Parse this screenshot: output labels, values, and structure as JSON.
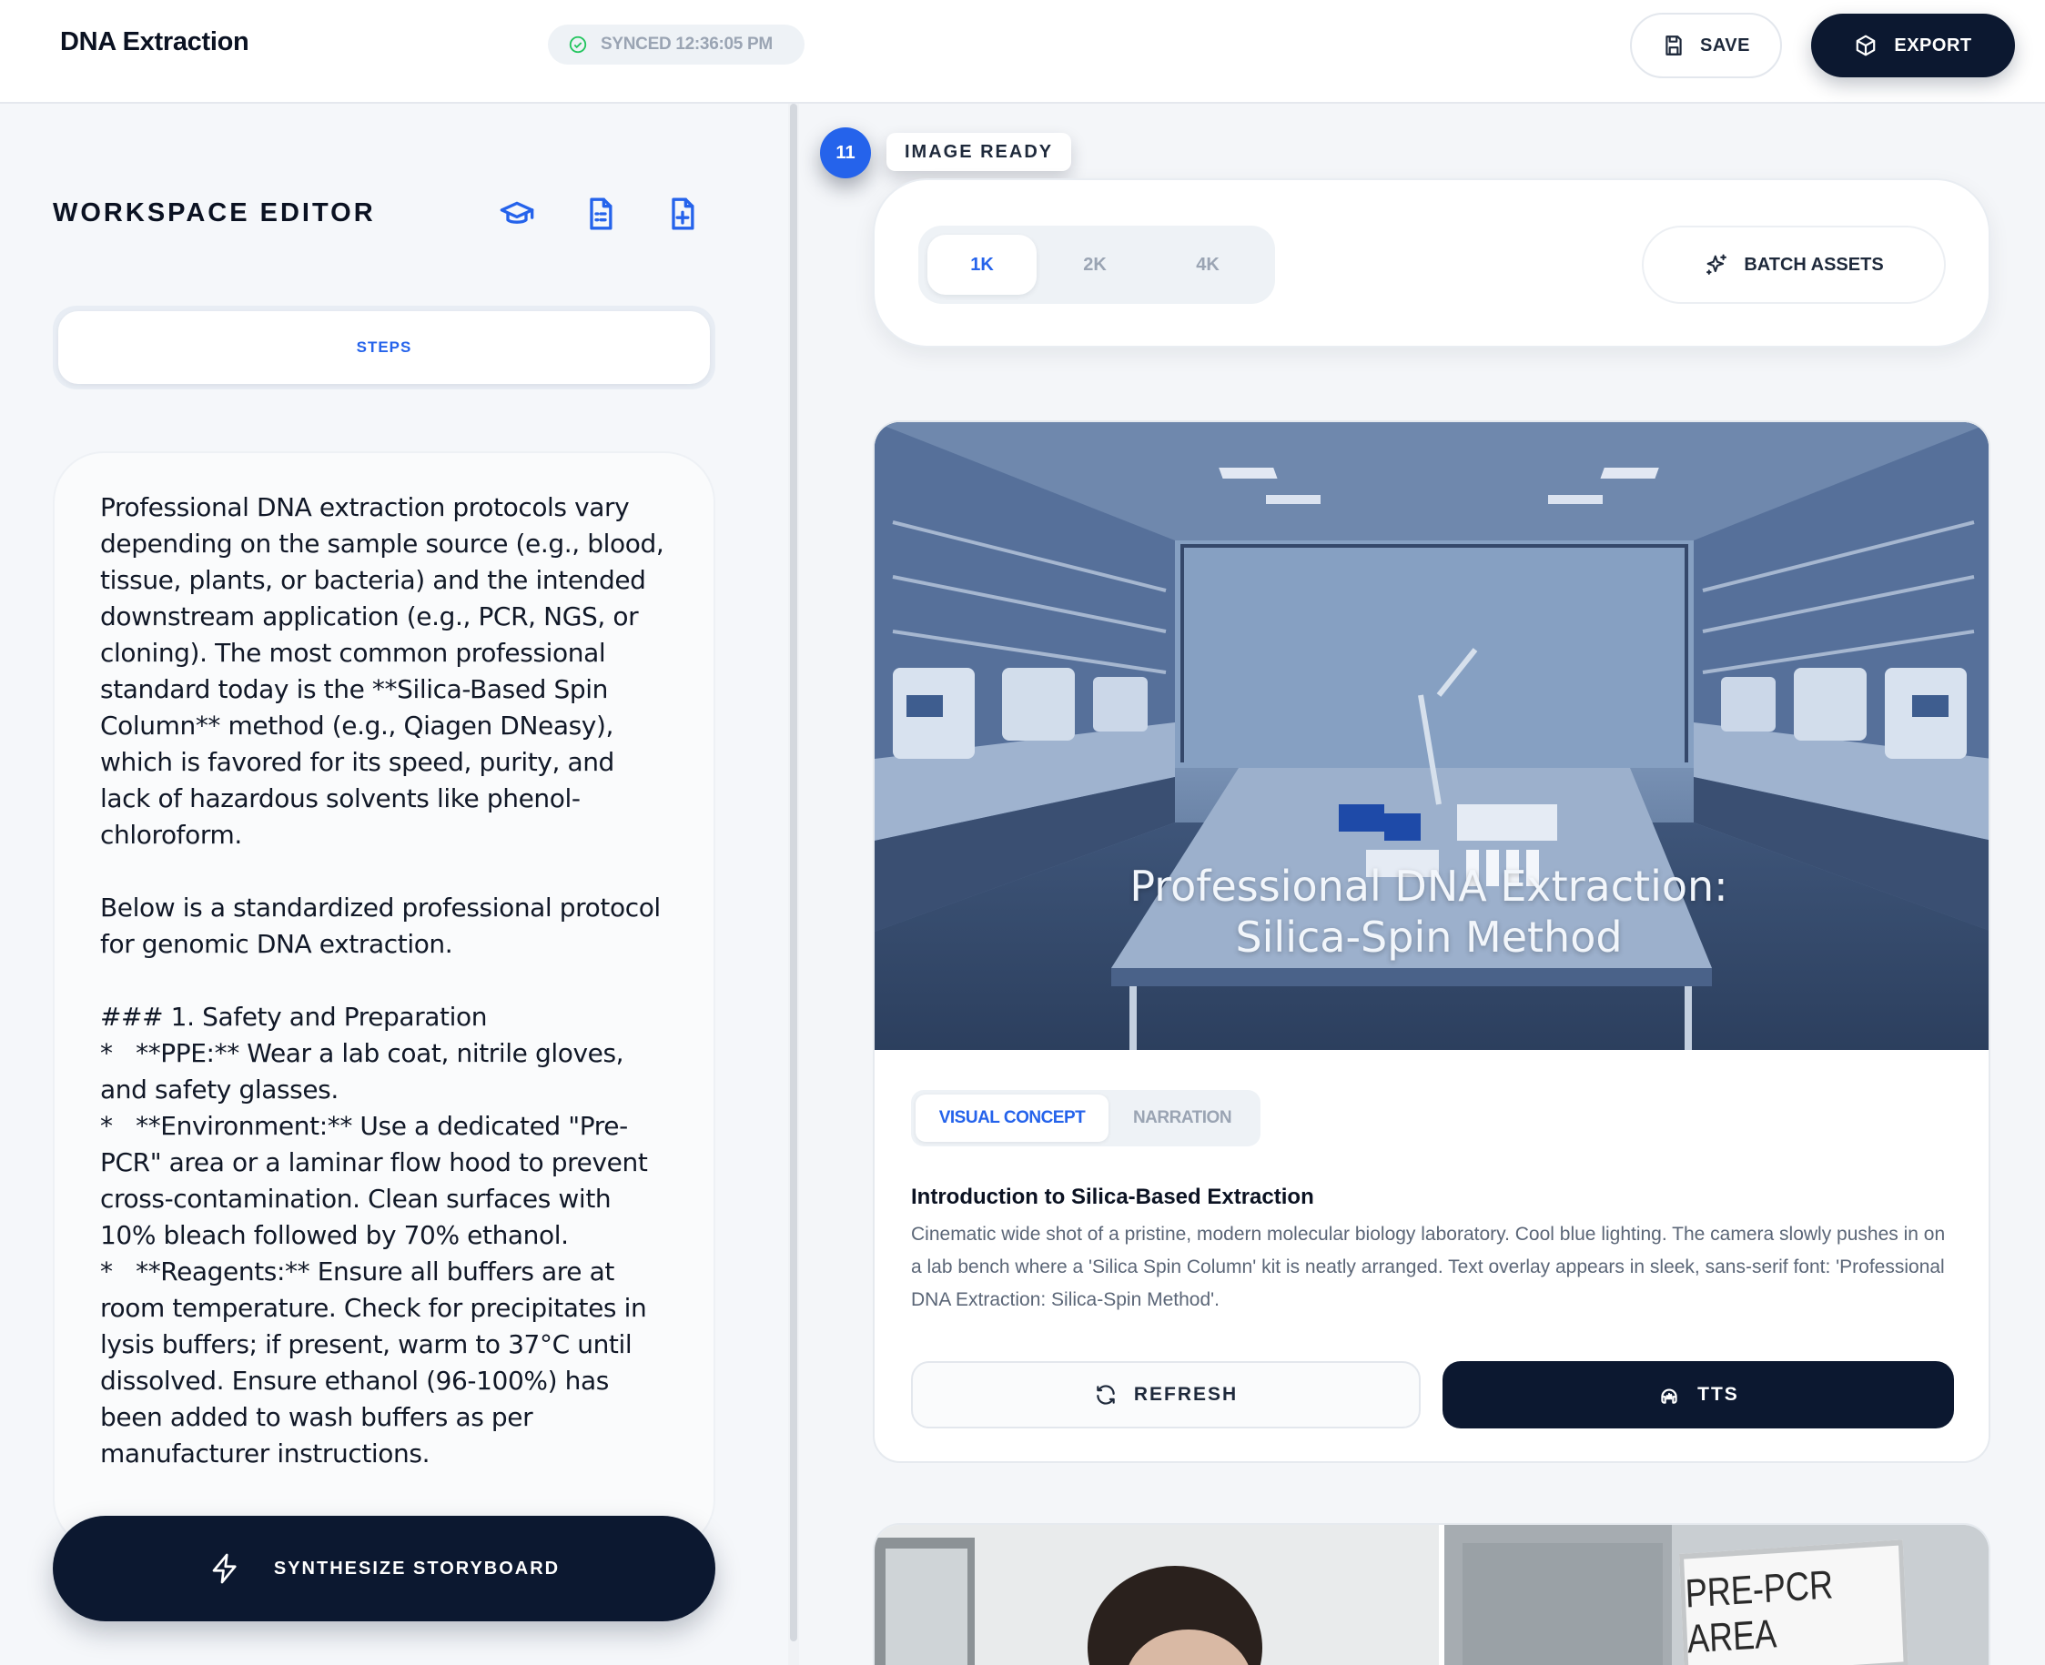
{
  "header": {
    "title": "DNA Extraction",
    "sync_status": "SYNCED 12:36:05 PM",
    "save_label": "SAVE",
    "export_label": "EXPORT"
  },
  "left_panel": {
    "title": "WORKSPACE EDITOR",
    "tool_icons": [
      "graduation-cap-icon",
      "file-list-icon",
      "file-plus-icon"
    ],
    "tab_label": "STEPS",
    "editor_text": "Professional DNA extraction protocols vary depending on the sample source (e.g., blood, tissue, plants, or bacteria) and the intended downstream application (e.g., PCR, NGS, or cloning). The most common professional standard today is the **Silica-Based Spin Column** method (e.g., Qiagen DNeasy), which is favored for its speed, purity, and lack of hazardous solvents like phenol-chloroform.\n\nBelow is a standardized professional protocol for genomic DNA extraction.\n\n### 1. Safety and Preparation\n*   **PPE:** Wear a lab coat, nitrile gloves, and safety glasses.\n*   **Environment:** Use a dedicated \"Pre-PCR\" area or a laminar flow hood to prevent cross-contamination. Clean surfaces with 10% bleach followed by 70% ethanol.\n*   **Reagents:** Ensure all buffers are at room temperature. Check for precipitates in lysis buffers; if present, warm to 37°C until dissolved. Ensure ethanol (96-100%) has been added to wash buffers as per manufacturer instructions.",
    "synthesize_label": "SYNTHESIZE STORYBOARD"
  },
  "right_panel": {
    "step_number": "11",
    "status": "IMAGE READY",
    "resolutions": [
      "1K",
      "2K",
      "4K"
    ],
    "selected_resolution": "1K",
    "batch_label": "BATCH ASSETS",
    "scene": {
      "image_overlay_line1": "Professional DNA Extraction:",
      "image_overlay_line2": "Silica-Spin Method",
      "tabs": [
        "VISUAL CONCEPT",
        "NARRATION"
      ],
      "active_tab": "VISUAL CONCEPT",
      "heading": "Introduction to Silica-Based Extraction",
      "description": "Cinematic wide shot of a pristine, modern molecular biology laboratory. Cool blue lighting. The camera slowly pushes in on a lab bench where a 'Silica Spin Column' kit is neatly arranged. Text overlay appears in sleek, sans-serif font: 'Professional DNA Extraction: Silica-Spin Method'.",
      "refresh_label": "REFRESH",
      "tts_label": "TTS"
    },
    "next_scene": {
      "sign_text": "PRE-PCR AREA"
    }
  },
  "colors": {
    "accent": "#2563eb",
    "primary_dark": "#0c1830",
    "sync_green": "#22c55e"
  }
}
